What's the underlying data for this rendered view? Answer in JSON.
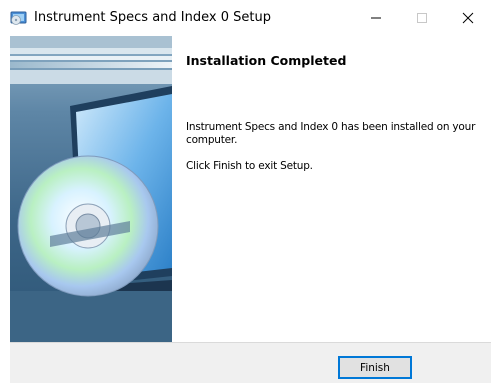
{
  "window": {
    "title": "Instrument Specs and Index 0 Setup",
    "icon": "installer-icon",
    "controls": {
      "minimize": "minimize-icon",
      "maximize": "maximize-icon",
      "close": "close-icon"
    }
  },
  "sidebar": {
    "image": "cd-disc-monitor-banner"
  },
  "content": {
    "heading": "Installation Completed",
    "message": "Instrument Specs and Index 0 has been installed on your computer.",
    "instruction": "Click Finish to exit Setup."
  },
  "footer": {
    "finish_label": "Finish"
  },
  "colors": {
    "focus_border": "#0078d7",
    "footer_bg": "#f0f0f0",
    "button_bg": "#e1e1e1"
  }
}
